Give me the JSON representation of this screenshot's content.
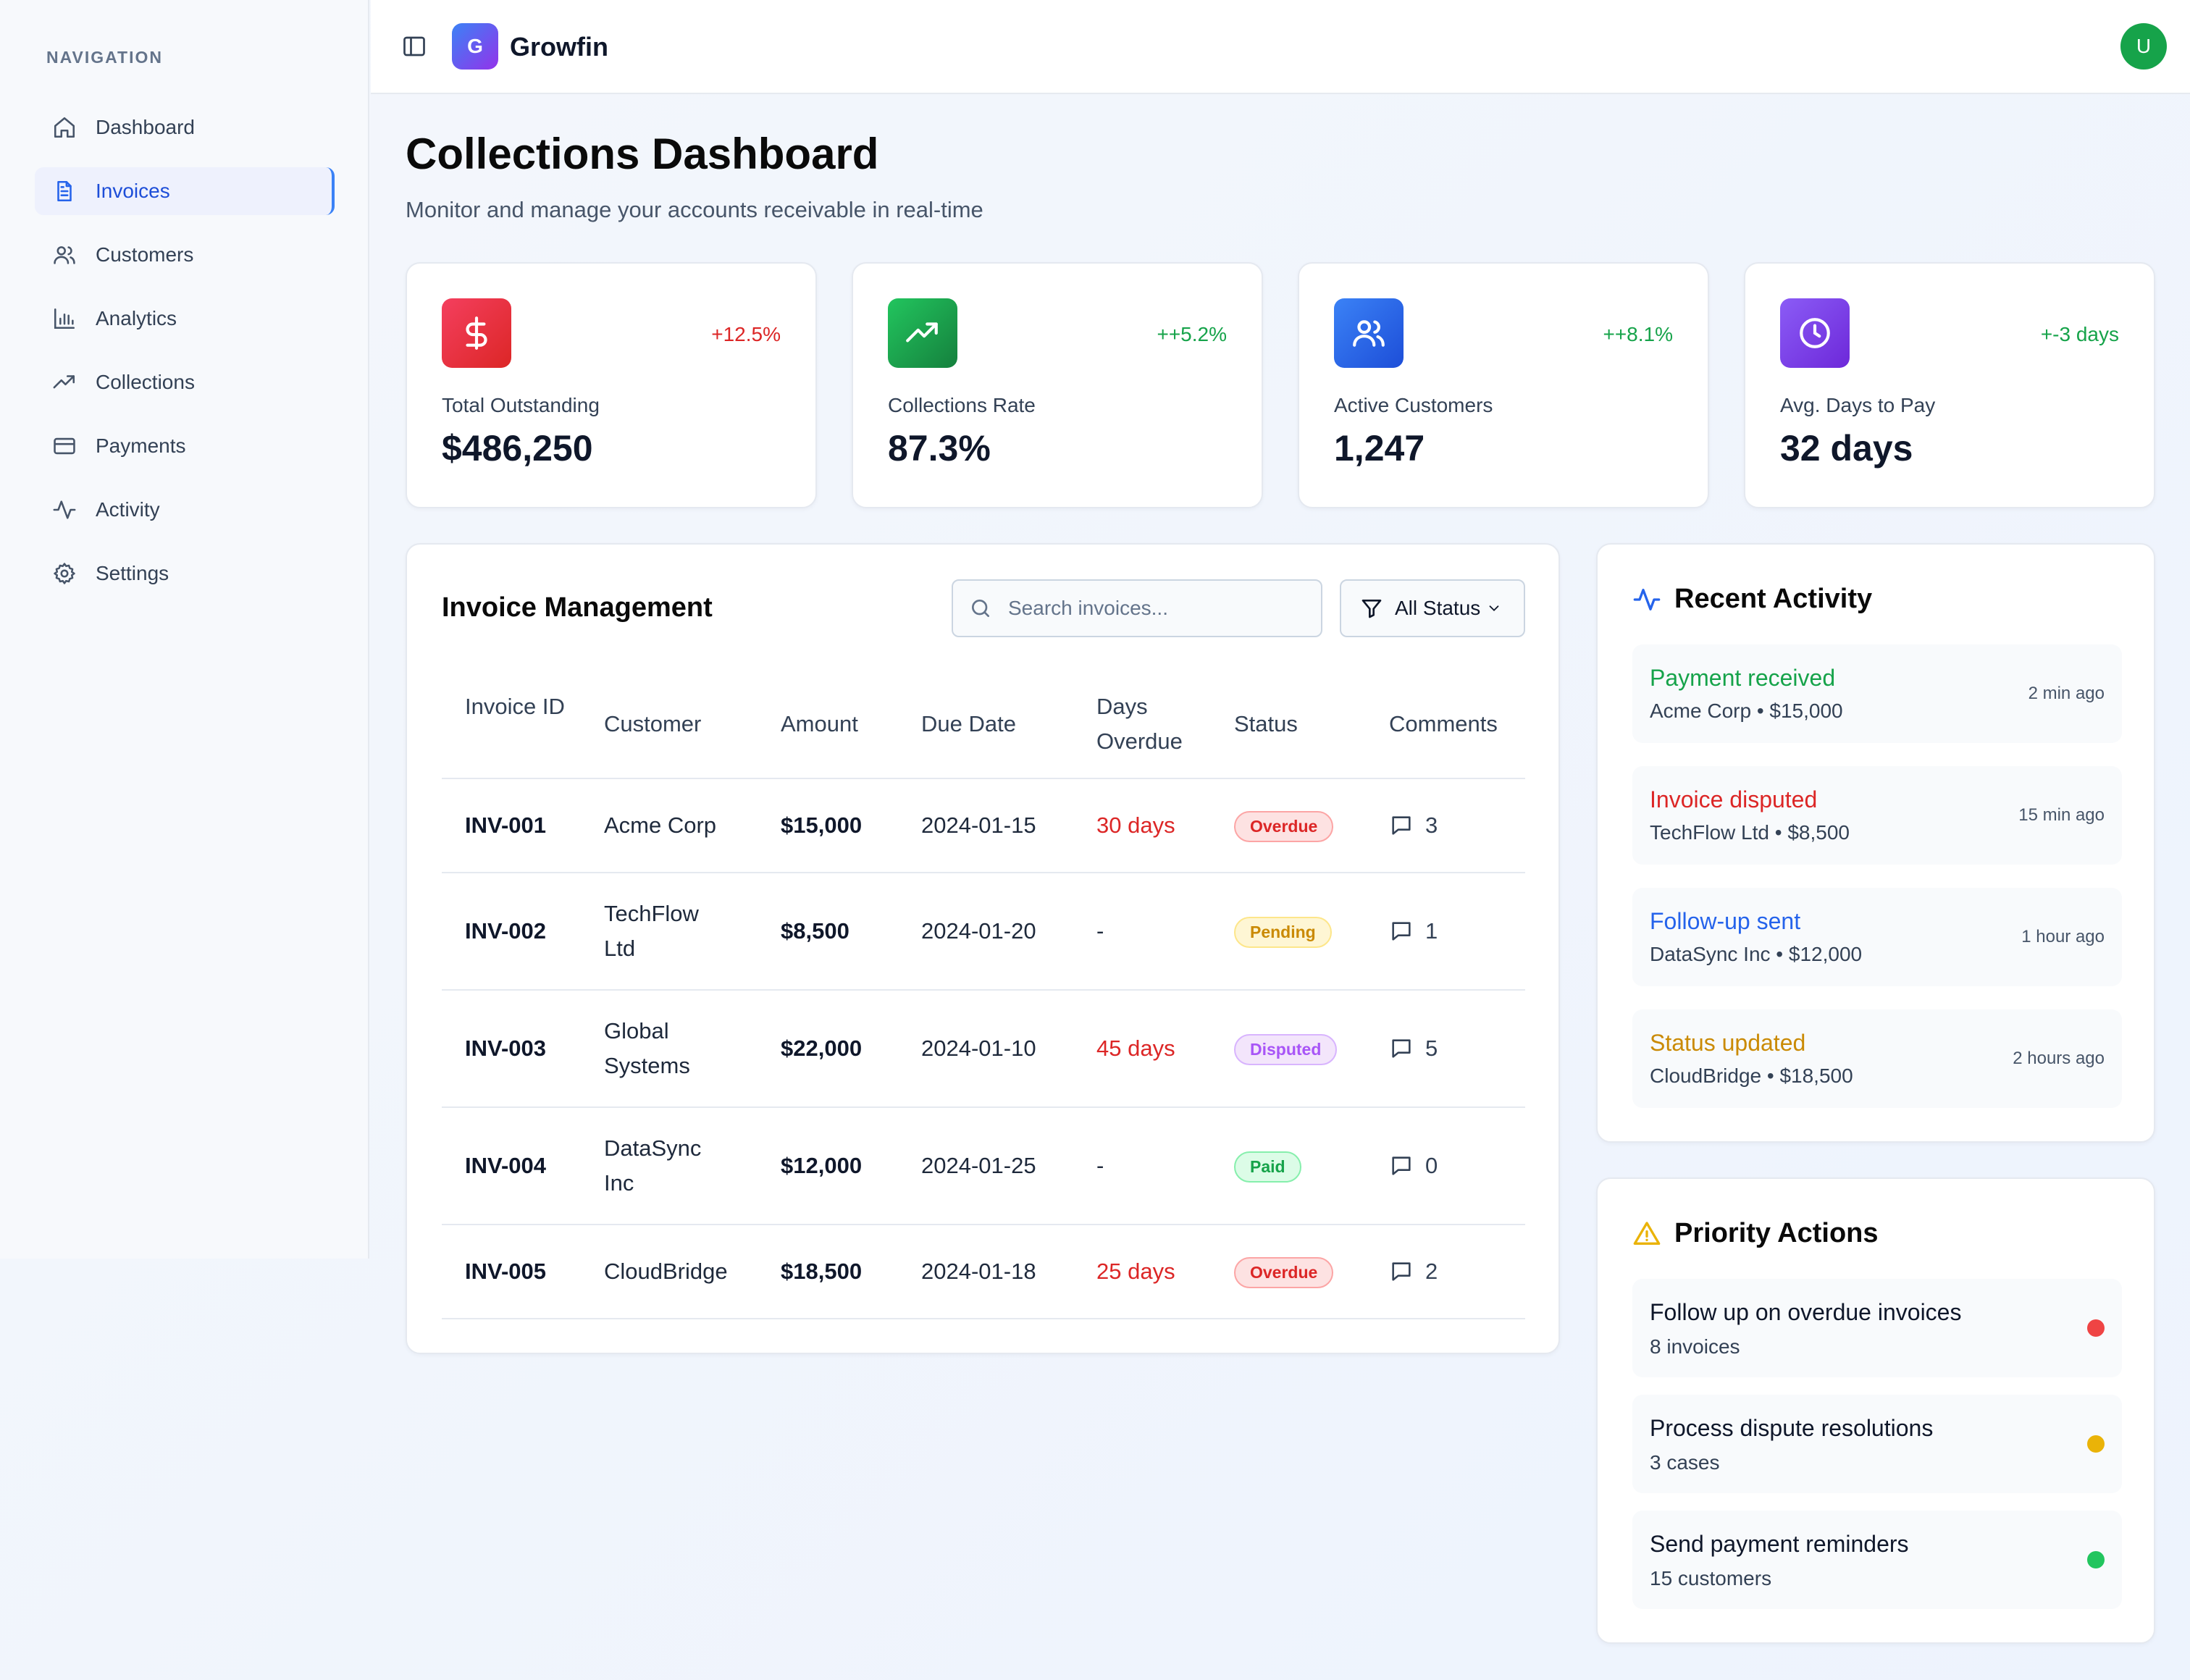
{
  "sidebar": {
    "heading": "NAVIGATION",
    "items": [
      {
        "label": "Dashboard",
        "icon": "home-icon"
      },
      {
        "label": "Invoices",
        "icon": "file-text-icon",
        "active": true
      },
      {
        "label": "Customers",
        "icon": "users-icon"
      },
      {
        "label": "Analytics",
        "icon": "bar-chart-icon"
      },
      {
        "label": "Collections",
        "icon": "trending-up-icon"
      },
      {
        "label": "Payments",
        "icon": "credit-card-icon"
      },
      {
        "label": "Activity",
        "icon": "activity-icon"
      },
      {
        "label": "Settings",
        "icon": "gear-icon"
      }
    ]
  },
  "header": {
    "logo_letter": "G",
    "brand": "Growfin",
    "avatar_letter": "U"
  },
  "page": {
    "title": "Collections Dashboard",
    "subtitle": "Monitor and manage your accounts receivable in real-time"
  },
  "stats": [
    {
      "label": "Total Outstanding",
      "value": "$486,250",
      "change": "+12.5%",
      "change_color": "#dc2626",
      "icon": "dollar-icon",
      "icon_bg": "#e11d48"
    },
    {
      "label": "Collections Rate",
      "value": "87.3%",
      "change": "++5.2%",
      "change_color": "#16a34a",
      "icon": "trending-up-icon",
      "icon_bg": "#16a34a"
    },
    {
      "label": "Active Customers",
      "value": "1,247",
      "change": "++8.1%",
      "change_color": "#16a34a",
      "icon": "users-icon",
      "icon_bg": "#2563eb"
    },
    {
      "label": "Avg. Days to Pay",
      "value": "32 days",
      "change": "+-3 days",
      "change_color": "#16a34a",
      "icon": "clock-icon",
      "icon_bg": "#7c3aed"
    }
  ],
  "invoices": {
    "title": "Invoice Management",
    "search_placeholder": "Search invoices...",
    "filter_label": "All Status",
    "columns": [
      "Invoice ID",
      "Customer",
      "Amount",
      "Due Date",
      "Days Overdue",
      "Status",
      "Comments"
    ],
    "rows": [
      {
        "id": "INV-001",
        "customer": "Acme Corp",
        "amount": "$15,000",
        "due": "2024-01-15",
        "days": "30 days",
        "status": "Overdue",
        "comments": "3"
      },
      {
        "id": "INV-002",
        "customer": "TechFlow Ltd",
        "amount": "$8,500",
        "due": "2024-01-20",
        "days": "-",
        "status": "Pending",
        "comments": "1"
      },
      {
        "id": "INV-003",
        "customer": "Global Systems",
        "amount": "$22,000",
        "due": "2024-01-10",
        "days": "45 days",
        "status": "Disputed",
        "comments": "5"
      },
      {
        "id": "INV-004",
        "customer": "DataSync Inc",
        "amount": "$12,000",
        "due": "2024-01-25",
        "days": "-",
        "status": "Paid",
        "comments": "0"
      },
      {
        "id": "INV-005",
        "customer": "CloudBridge",
        "amount": "$18,500",
        "due": "2024-01-18",
        "days": "25 days",
        "status": "Overdue",
        "comments": "2"
      }
    ]
  },
  "activity": {
    "title": "Recent Activity",
    "items": [
      {
        "label": "Payment received",
        "sub": "Acme Corp • $15,000",
        "time": "2 min ago",
        "color": "#16a34a"
      },
      {
        "label": "Invoice disputed",
        "sub": "TechFlow Ltd • $8,500",
        "time": "15 min ago",
        "color": "#dc2626"
      },
      {
        "label": "Follow-up sent",
        "sub": "DataSync Inc • $12,000",
        "time": "1 hour ago",
        "color": "#2563eb"
      },
      {
        "label": "Status updated",
        "sub": "CloudBridge • $18,500",
        "time": "2 hours ago",
        "color": "#ca8a04"
      }
    ]
  },
  "priority": {
    "title": "Priority Actions",
    "items": [
      {
        "label": "Follow up on overdue invoices",
        "sub": "8 invoices",
        "dot": "#ef4444"
      },
      {
        "label": "Process dispute resolutions",
        "sub": "3 cases",
        "dot": "#eab308"
      },
      {
        "label": "Send payment reminders",
        "sub": "15 customers",
        "dot": "#22c55e"
      }
    ]
  }
}
